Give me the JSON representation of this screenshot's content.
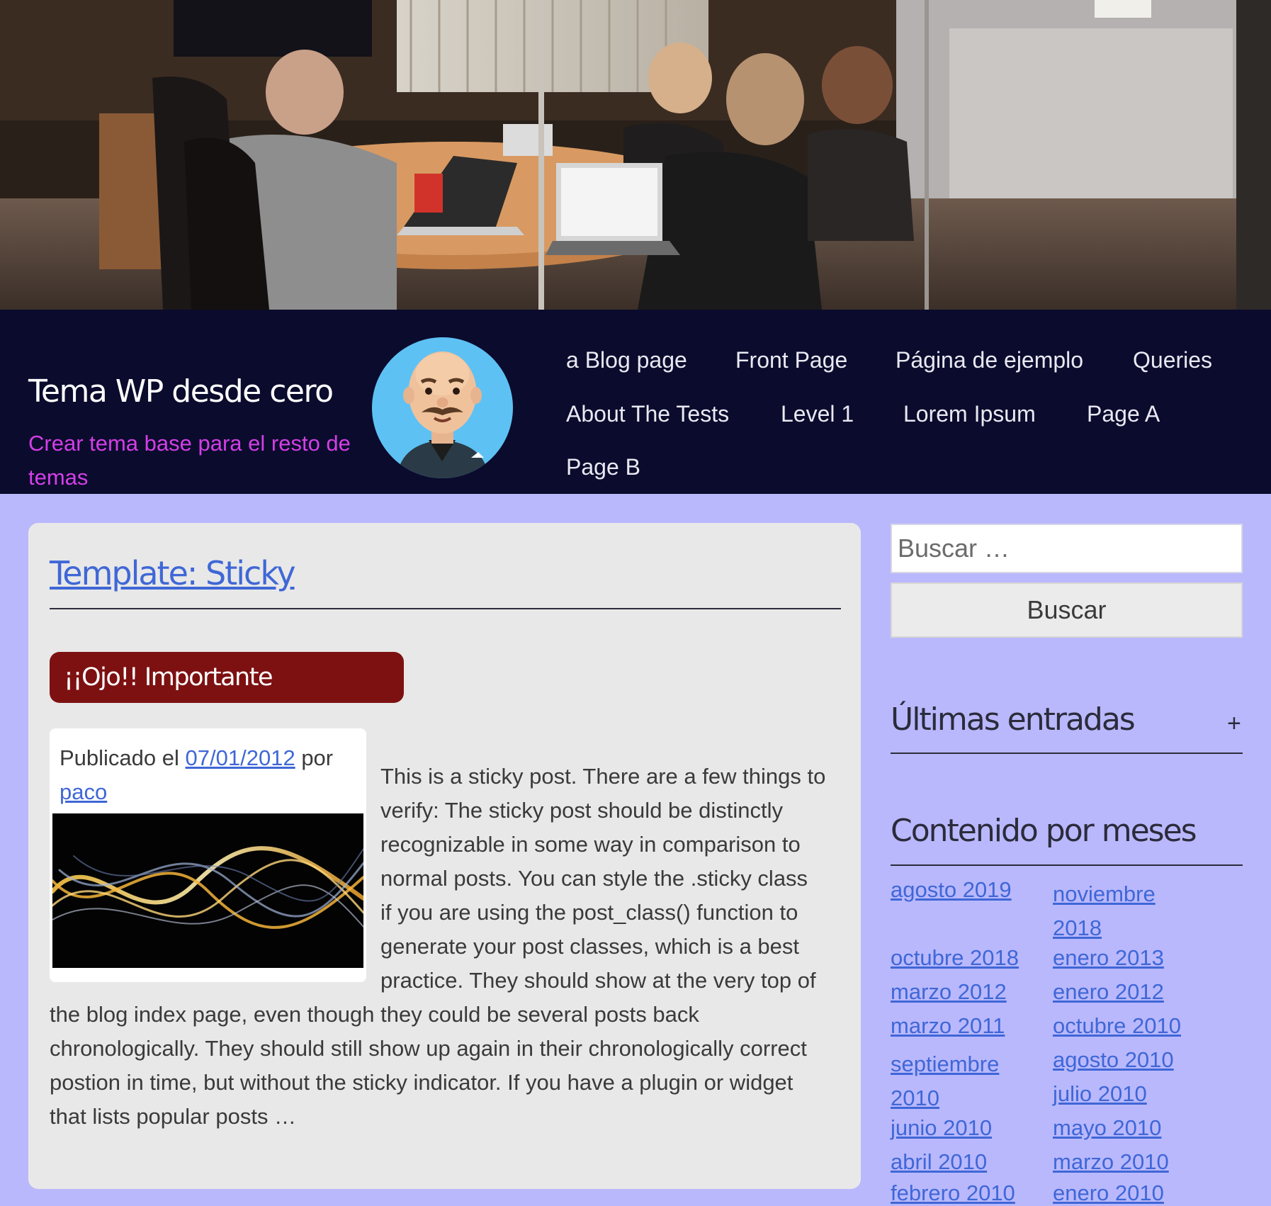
{
  "site": {
    "title": "Tema WP desde cero",
    "description": "Crear tema base para el resto de temas"
  },
  "nav": {
    "items": [
      {
        "label": "a Blog page"
      },
      {
        "label": "Front Page"
      },
      {
        "label": "Página de ejemplo"
      },
      {
        "label": "Queries"
      },
      {
        "label": "About The Tests"
      },
      {
        "label": "Level 1"
      },
      {
        "label": "Lorem Ipsum"
      },
      {
        "label": "Page A"
      },
      {
        "label": "Page B"
      }
    ]
  },
  "post": {
    "title": "Template: Sticky",
    "sticky_label": "¡¡Ojo!! Importante",
    "meta_prefix": "Publicado el",
    "date": "07/01/2012",
    "meta_by": "por",
    "author": "paco",
    "excerpt_lines": [
      "This is a sticky post. There are a few things to",
      "verify: The sticky post should be distinctly",
      "recognizable in some way in comparison to",
      "normal posts. You can style the .sticky class",
      "if you are using the post_class() function to",
      "generate your post classes, which is a best",
      "practice. They should show at the very top of",
      "the blog index page, even though they could be several posts back",
      "chronologically. They should still show up again in their chronologically correct",
      "postion in time, but without the sticky indicator. If you have a plugin or widget",
      "that lists popular posts …"
    ]
  },
  "sidebar": {
    "search_placeholder": "Buscar …",
    "search_button": "Buscar",
    "recent_title": "Últimas entradas",
    "recent_toggle": "+",
    "archive_title": "Contenido por meses",
    "archive_links": [
      "agosto 2019",
      "noviembre 2018",
      "octubre 2018",
      "enero 2013",
      "marzo 2012",
      "enero 2012",
      "marzo 2011",
      "octubre 2010",
      "septiembre 2010",
      "agosto 2010",
      "junio 2010",
      "julio 2010",
      "abril 2010",
      "mayo 2010",
      "febrero 2010",
      "marzo 2010",
      "enero 2010"
    ]
  },
  "colors": {
    "page_background": "#b9b8fd",
    "header_background": "#0b0b2d",
    "tagline": "#d33fe6",
    "link": "#3f67d6",
    "sticky_badge": "#7d1111",
    "card": "#e8e8e8"
  },
  "icons": {
    "avatar": "bald-man-mustache-avatar",
    "hero": "office-meeting-photo",
    "thumbnail": "light-waves-image"
  }
}
